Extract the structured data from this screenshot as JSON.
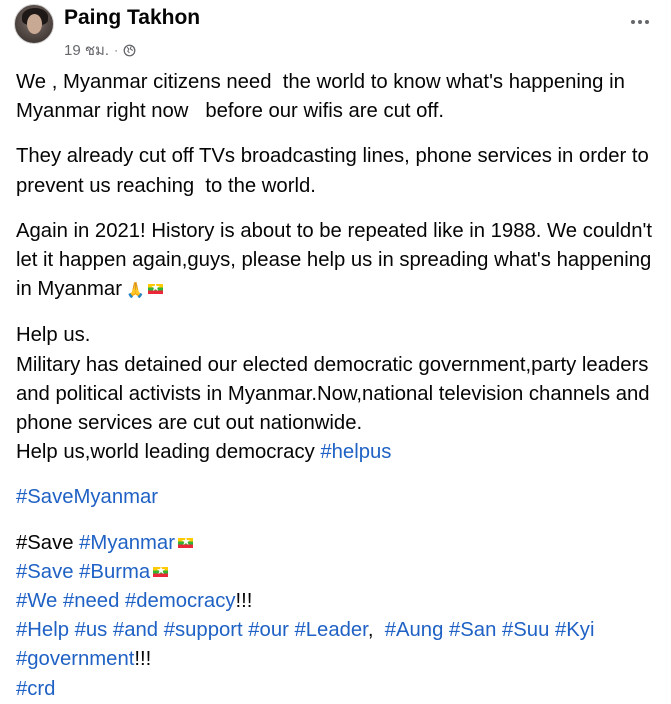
{
  "post": {
    "author": "Paing Takhon",
    "time": "19 ชม.",
    "dot": "·",
    "icons": [
      "globe-icon",
      "more-options-icon",
      "folded-hands-icon",
      "myanmar-flag-icon"
    ],
    "colors": {
      "hashtag": "#1f61c4",
      "meta": "#65676b"
    },
    "paragraphs": {
      "p1": "We , Myanmar citizens need  the world to know what's happening in Myanmar right now   before our wifis are cut off.",
      "p2": "They already cut off TVs broadcasting lines, phone services in order to prevent us reaching  to the world.",
      "p3": "Again in 2021! History is about to be repeated like in 1988. We couldn't let it happen again,guys, please help us in spreading what's happening in Myanmar",
      "p4_l1": "Help us.",
      "p4_l2": "Military has detained our elected democratic government,party leaders and political activists in Myanmar.Now,national television channels and phone services are cut out nationwide.",
      "p4_l3": "Help us,world leading democracy "
    },
    "hashtags": {
      "helpus": "#helpus",
      "savemyanmar": "#SaveMyanmar",
      "save1": "#Save ",
      "myanmar": "#Myanmar",
      "save2": "#Save ",
      "burma": "#Burma",
      "we_need_democracy": "#We #need #democracy",
      "excl1": "!!!",
      "help_line": "#Help #us #and #support #our #Leader",
      "comma": ",  ",
      "aung_line": "#Aung #San #Suu #Kyi",
      "government": "#government",
      "excl2": "!!!",
      "crd": "#crd"
    }
  }
}
